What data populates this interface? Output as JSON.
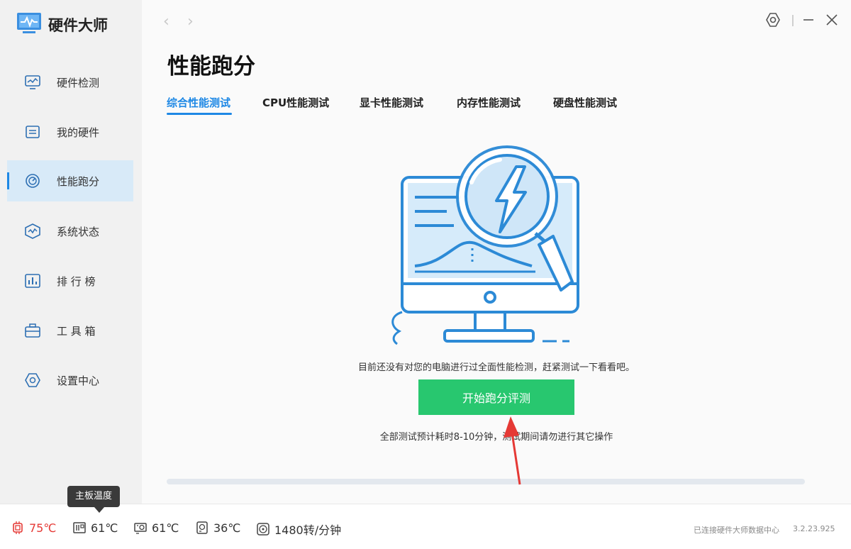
{
  "app": {
    "title": "硬件大师",
    "logo_icon": "monitor-pulse-icon"
  },
  "sidebar": {
    "items": [
      {
        "label": "硬件检测",
        "icon": "hardware-check-icon"
      },
      {
        "label": "我的硬件",
        "icon": "my-hardware-icon"
      },
      {
        "label": "性能跑分",
        "icon": "speedometer-icon",
        "active": true
      },
      {
        "label": "系统状态",
        "icon": "system-status-icon"
      },
      {
        "label": "排 行 榜",
        "icon": "ranking-icon"
      },
      {
        "label": "工 具 箱",
        "icon": "toolbox-icon"
      },
      {
        "label": "设置中心",
        "icon": "settings-icon"
      }
    ]
  },
  "window": {
    "controls": [
      "settings-icon",
      "minimize-icon",
      "close-icon"
    ]
  },
  "page": {
    "title": "性能跑分",
    "tabs": [
      {
        "label": "综合性能测试",
        "active": true
      },
      {
        "label": "CPU性能测试"
      },
      {
        "label": "显卡性能测试"
      },
      {
        "label": "内存性能测试"
      },
      {
        "label": "硬盘性能测试"
      }
    ],
    "message": "目前还没有对您的电脑进行过全面性能检测，赶紧测试一下看看吧。",
    "start_button": "开始跑分评测",
    "note": "全部测试预计耗时8-10分钟，测试期间请勿进行其它操作",
    "progress": 0
  },
  "status": {
    "tooltip": "主板温度",
    "items": [
      {
        "value": "75℃",
        "icon": "cpu-temp-icon"
      },
      {
        "value": "61℃",
        "icon": "motherboard-temp-icon"
      },
      {
        "value": "61℃",
        "icon": "gpu-temp-icon"
      },
      {
        "value": "36℃",
        "icon": "disk-temp-icon"
      },
      {
        "value": "1480转/分钟",
        "icon": "fan-icon"
      }
    ],
    "connection": "已连接硬件大师数据中心",
    "version": "3.2.23.925"
  },
  "colors": {
    "accent": "#1e88e5",
    "button": "#28c76f",
    "hot": "#e53935"
  }
}
